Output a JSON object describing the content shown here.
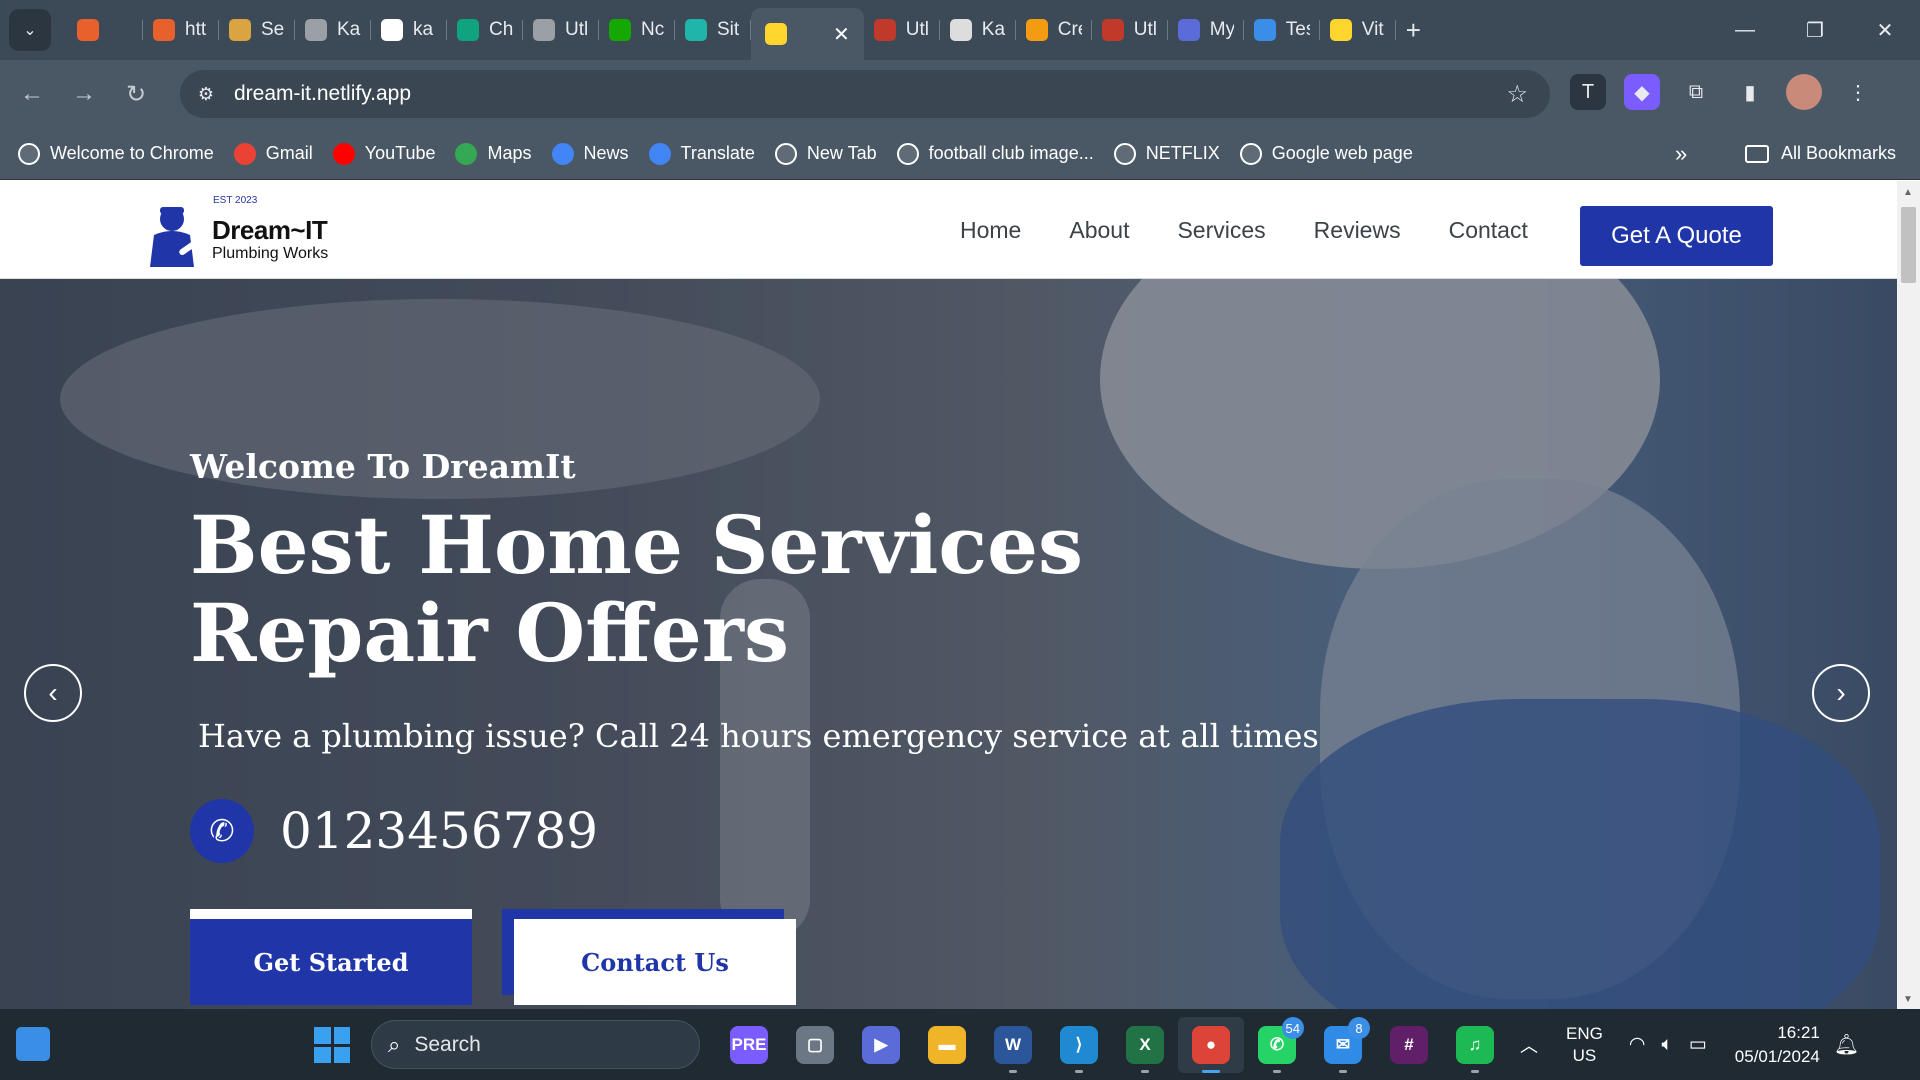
{
  "browser": {
    "tabs": [
      {
        "label": "",
        "color": "#e8612c"
      },
      {
        "label": "htt",
        "color": "#e8612c"
      },
      {
        "label": "Se",
        "color": "#d9a441"
      },
      {
        "label": "Ka",
        "color": "#9aa0a6"
      },
      {
        "label": "ka",
        "color": "#ffffff"
      },
      {
        "label": "Ch",
        "color": "#10a37f"
      },
      {
        "label": "Utl",
        "color": "#9aa0a6"
      },
      {
        "label": "Nc",
        "color": "#14a800"
      },
      {
        "label": "Sit",
        "color": "#1fb5a8"
      },
      {
        "label": "",
        "color": "#ffd62e",
        "active": true
      },
      {
        "label": "Utl",
        "color": "#c0392b"
      },
      {
        "label": "Ka",
        "color": "#dddddd"
      },
      {
        "label": "Cre",
        "color": "#f39c12"
      },
      {
        "label": "Utl",
        "color": "#c0392b"
      },
      {
        "label": "My",
        "color": "#5b6bd8"
      },
      {
        "label": "Tes",
        "color": "#3a8ee6"
      },
      {
        "label": "Vit",
        "color": "#ffd62e"
      }
    ],
    "new_tab_icon": "+",
    "close_tab_icon": "✕",
    "window_controls": {
      "minimize": "—",
      "restore": "❐",
      "close": "✕"
    },
    "url": "dream-it.netlify.app",
    "bookmarks": [
      {
        "label": "Welcome to Chrome",
        "color": "#ffffff",
        "icon": "globe-icon"
      },
      {
        "label": "Gmail",
        "color": "#ea4335",
        "icon": "gmail-icon"
      },
      {
        "label": "YouTube",
        "color": "#ff0000",
        "icon": "youtube-icon"
      },
      {
        "label": "Maps",
        "color": "#34a853",
        "icon": "maps-icon"
      },
      {
        "label": "News",
        "color": "#4285f4",
        "icon": "news-icon"
      },
      {
        "label": "Translate",
        "color": "#4285f4",
        "icon": "translate-icon"
      },
      {
        "label": "New Tab",
        "color": "#ffffff",
        "icon": "globe-icon"
      },
      {
        "label": "football club image...",
        "color": "#ffffff",
        "icon": "google-icon"
      },
      {
        "label": "NETFLIX",
        "color": "#ffffff",
        "icon": "globe-icon"
      },
      {
        "label": "Google web page",
        "color": "#ffffff",
        "icon": "globe-icon"
      }
    ],
    "bookmarks_more": "»",
    "all_bookmarks": "All Bookmarks"
  },
  "site": {
    "logo": {
      "est": "EST 2023",
      "name": "Dream~IT",
      "sub": "Plumbing Works"
    },
    "nav": [
      "Home",
      "About",
      "Services",
      "Reviews",
      "Contact"
    ],
    "cta": "Get A Quote",
    "hero": {
      "welcome": "Welcome To DreamIt",
      "headline_line1": "Best Home Services",
      "headline_line2": "Repair Offers",
      "subline": "Have a plumbing issue? Call 24 hours emergency service at all times",
      "phone": "0123456789",
      "btn_start": "Get Started",
      "btn_contact": "Contact Us",
      "prev": "‹",
      "next": "›"
    },
    "accent": "#1f35a8"
  },
  "taskbar": {
    "search_placeholder": "Search",
    "apps": [
      {
        "name": "copilot",
        "label": "PRE",
        "color": "#7b5cff"
      },
      {
        "name": "task-view",
        "label": "▢",
        "color": "#6b7784"
      },
      {
        "name": "teams-chat",
        "label": "▶",
        "color": "#5b6bd8"
      },
      {
        "name": "file-explorer",
        "label": "▬",
        "color": "#f0b429"
      },
      {
        "name": "word",
        "label": "W",
        "color": "#2b579a",
        "open": true
      },
      {
        "name": "vscode",
        "label": "⟩",
        "color": "#1f8ad2",
        "open": true
      },
      {
        "name": "excel",
        "label": "X",
        "color": "#217346",
        "open": true
      },
      {
        "name": "chrome",
        "label": "●",
        "color": "#db4437",
        "open": true,
        "active": true
      },
      {
        "name": "whatsapp",
        "label": "✆",
        "color": "#25d366",
        "badge": "54",
        "open": true
      },
      {
        "name": "mail",
        "label": "✉",
        "color": "#2f8be6",
        "badge": "8",
        "open": true
      },
      {
        "name": "slack",
        "label": "#",
        "color": "#611f69"
      },
      {
        "name": "spotify",
        "label": "♫",
        "color": "#1db954",
        "open": true
      }
    ],
    "lang_line1": "ENG",
    "lang_line2": "US",
    "time": "16:21",
    "date": "05/01/2024"
  }
}
